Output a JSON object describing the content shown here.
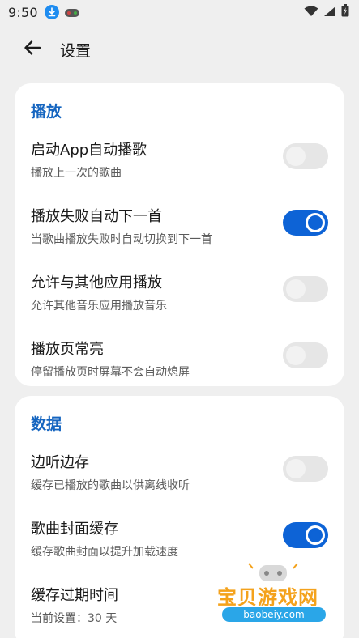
{
  "status_bar": {
    "time": "9:50"
  },
  "app_bar": {
    "title": "设置"
  },
  "sections": [
    {
      "title": "播放",
      "items": [
        {
          "title": "启动App自动播歌",
          "subtitle": "播放上一次的歌曲",
          "enabled": false
        },
        {
          "title": "播放失败自动下一首",
          "subtitle": "当歌曲播放失败时自动切换到下一首",
          "enabled": true
        },
        {
          "title": "允许与其他应用播放",
          "subtitle": "允许其他音乐应用播放音乐",
          "enabled": false
        },
        {
          "title": "播放页常亮",
          "subtitle": "停留播放页时屏幕不会自动熄屏",
          "enabled": false
        }
      ]
    },
    {
      "title": "数据",
      "items": [
        {
          "title": "边听边存",
          "subtitle": "缓存已播放的歌曲以供离线收听",
          "enabled": false
        },
        {
          "title": "歌曲封面缓存",
          "subtitle": "缓存歌曲封面以提升加载速度",
          "enabled": true
        },
        {
          "title": "缓存过期时间",
          "subtitle": "当前设置：30 天"
        }
      ]
    }
  ],
  "watermark": {
    "text": "宝贝游戏网",
    "url": "baobeiy.com"
  },
  "colors": {
    "accent": "#0d63d6",
    "section_title": "#1565c0",
    "background": "#efefef",
    "card": "#ffffff"
  },
  "icons": [
    "download-icon",
    "game-controller-icon",
    "wifi-icon",
    "signal-icon",
    "battery-charging-icon",
    "back-arrow-icon"
  ]
}
